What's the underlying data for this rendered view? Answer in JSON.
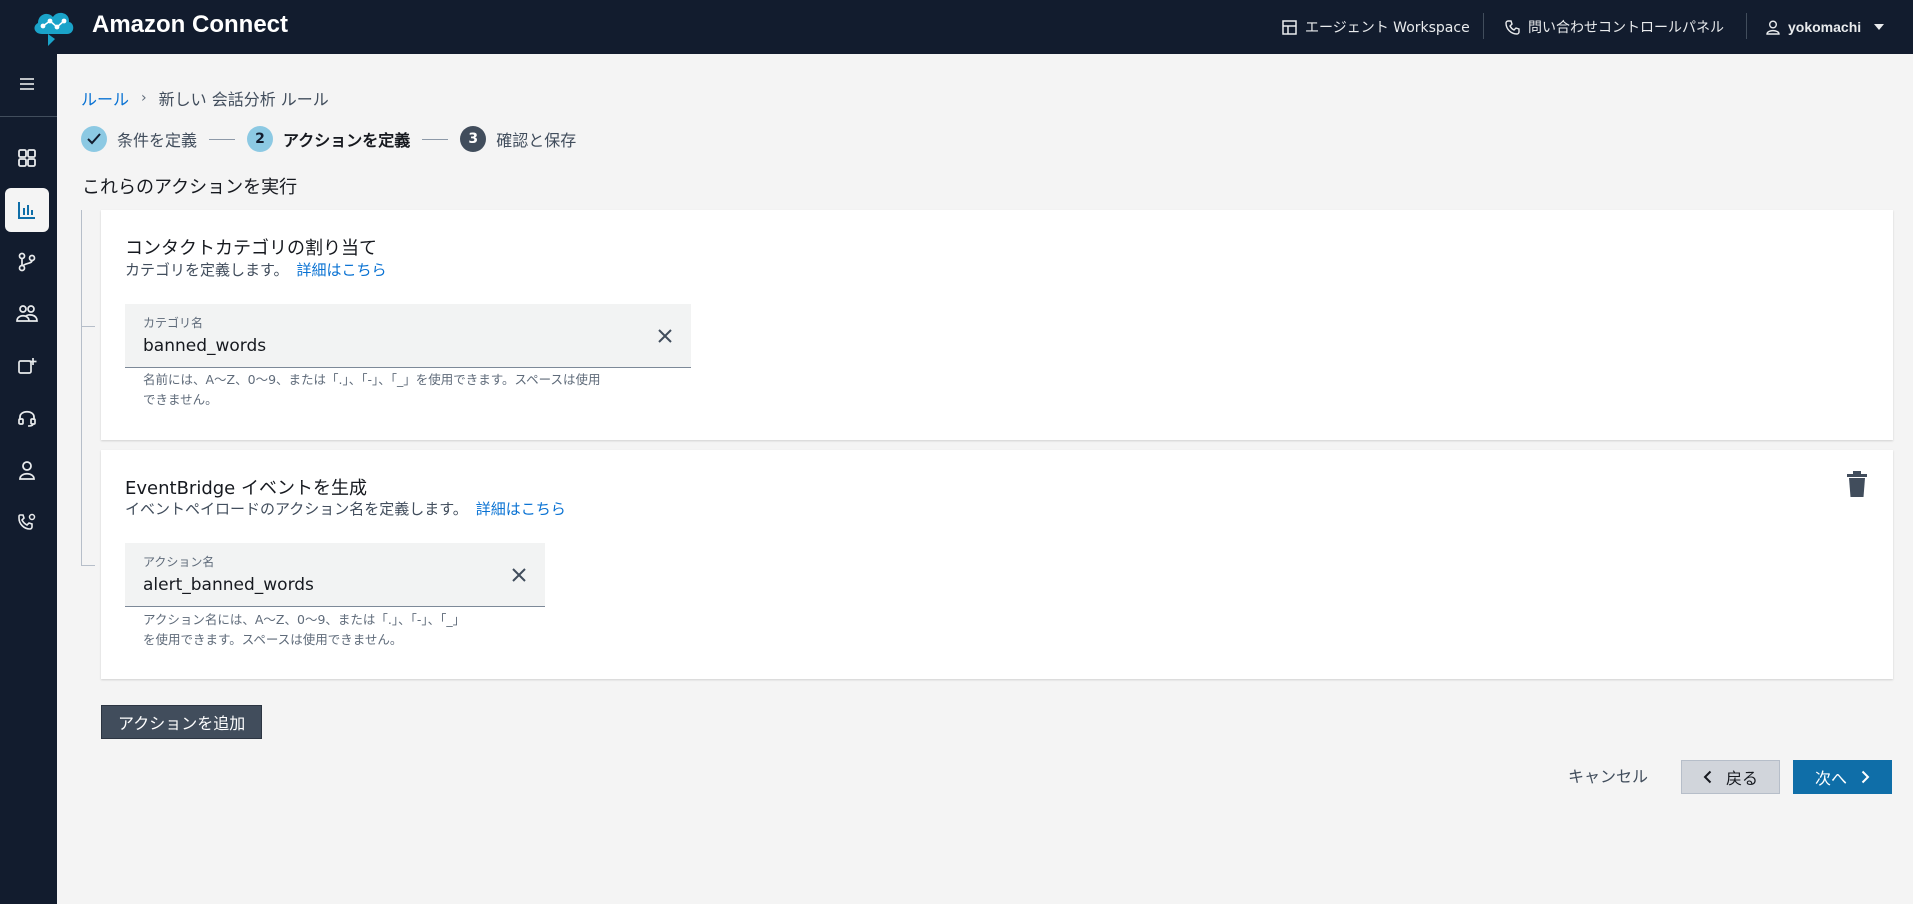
{
  "app": {
    "title": "Amazon Connect"
  },
  "header": {
    "agent_workspace": "エージェント Workspace",
    "contact_control_panel": "問い合わせコントロールパネル",
    "user": "yokomachi"
  },
  "sidebar": {
    "items": [
      {
        "icon": "menu-icon"
      },
      {
        "icon": "dashboard-icon"
      },
      {
        "icon": "analytics-icon",
        "active": true
      },
      {
        "icon": "routing-icon"
      },
      {
        "icon": "users-icon"
      },
      {
        "icon": "channels-icon"
      },
      {
        "icon": "headset-icon"
      },
      {
        "icon": "user-icon"
      },
      {
        "icon": "phone-settings-icon"
      }
    ]
  },
  "breadcrumb": {
    "root": "ルール",
    "current": "新しい 会話分析 ルール"
  },
  "steps": [
    {
      "label": "条件を定義",
      "state": "done"
    },
    {
      "num": "2",
      "label": "アクションを定義",
      "state": "current"
    },
    {
      "num": "3",
      "label": "確認と保存",
      "state": "todo"
    }
  ],
  "section_title": "これらのアクションを実行",
  "actions": [
    {
      "title": "コンタクトカテゴリの割り当て",
      "desc": "カテゴリを定義します。",
      "link": "詳細はこちら",
      "field_label": "カテゴリ名",
      "field_value": "banned_words",
      "hint_line1": "名前には、A～Z、0～9、または「.」、「-」、「_」を使用できます。スペースは使用",
      "hint_line2": "できません。"
    },
    {
      "title": "EventBridge イベントを生成",
      "desc": "イベントペイロードのアクション名を定義します。",
      "link": "詳細はこちら",
      "field_label": "アクション名",
      "field_value": "alert_banned_words",
      "hint_line1": "アクション名には、A～Z、0～9、または「.」、「-」、「_」",
      "hint_line2": "を使用できます。スペースは使用できません。"
    }
  ],
  "buttons": {
    "add_action": "アクションを追加",
    "cancel": "キャンセル",
    "back": "戻る",
    "next": "次へ"
  },
  "colors": {
    "header_bg": "#121c2e",
    "link": "#0972d3",
    "primary_button": "#0f6ea8",
    "step_done": "#8cc9e3"
  }
}
